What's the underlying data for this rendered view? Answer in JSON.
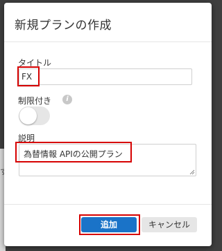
{
  "dialog": {
    "title": "新規プランの作成",
    "fields": {
      "title": {
        "label": "タイトル",
        "value": "FX"
      },
      "limit": {
        "label": "制限付き",
        "info_icon": "i",
        "enabled": false
      },
      "description": {
        "label": "説明",
        "value": "為替情報 APIの公開プラン"
      }
    },
    "buttons": {
      "add": "追加",
      "cancel": "キャンセル"
    }
  },
  "background": {
    "partial_text": "す"
  },
  "colors": {
    "primary": "#1a73c8",
    "highlight": "#d60000",
    "backdrop": "#3f3f3f"
  }
}
